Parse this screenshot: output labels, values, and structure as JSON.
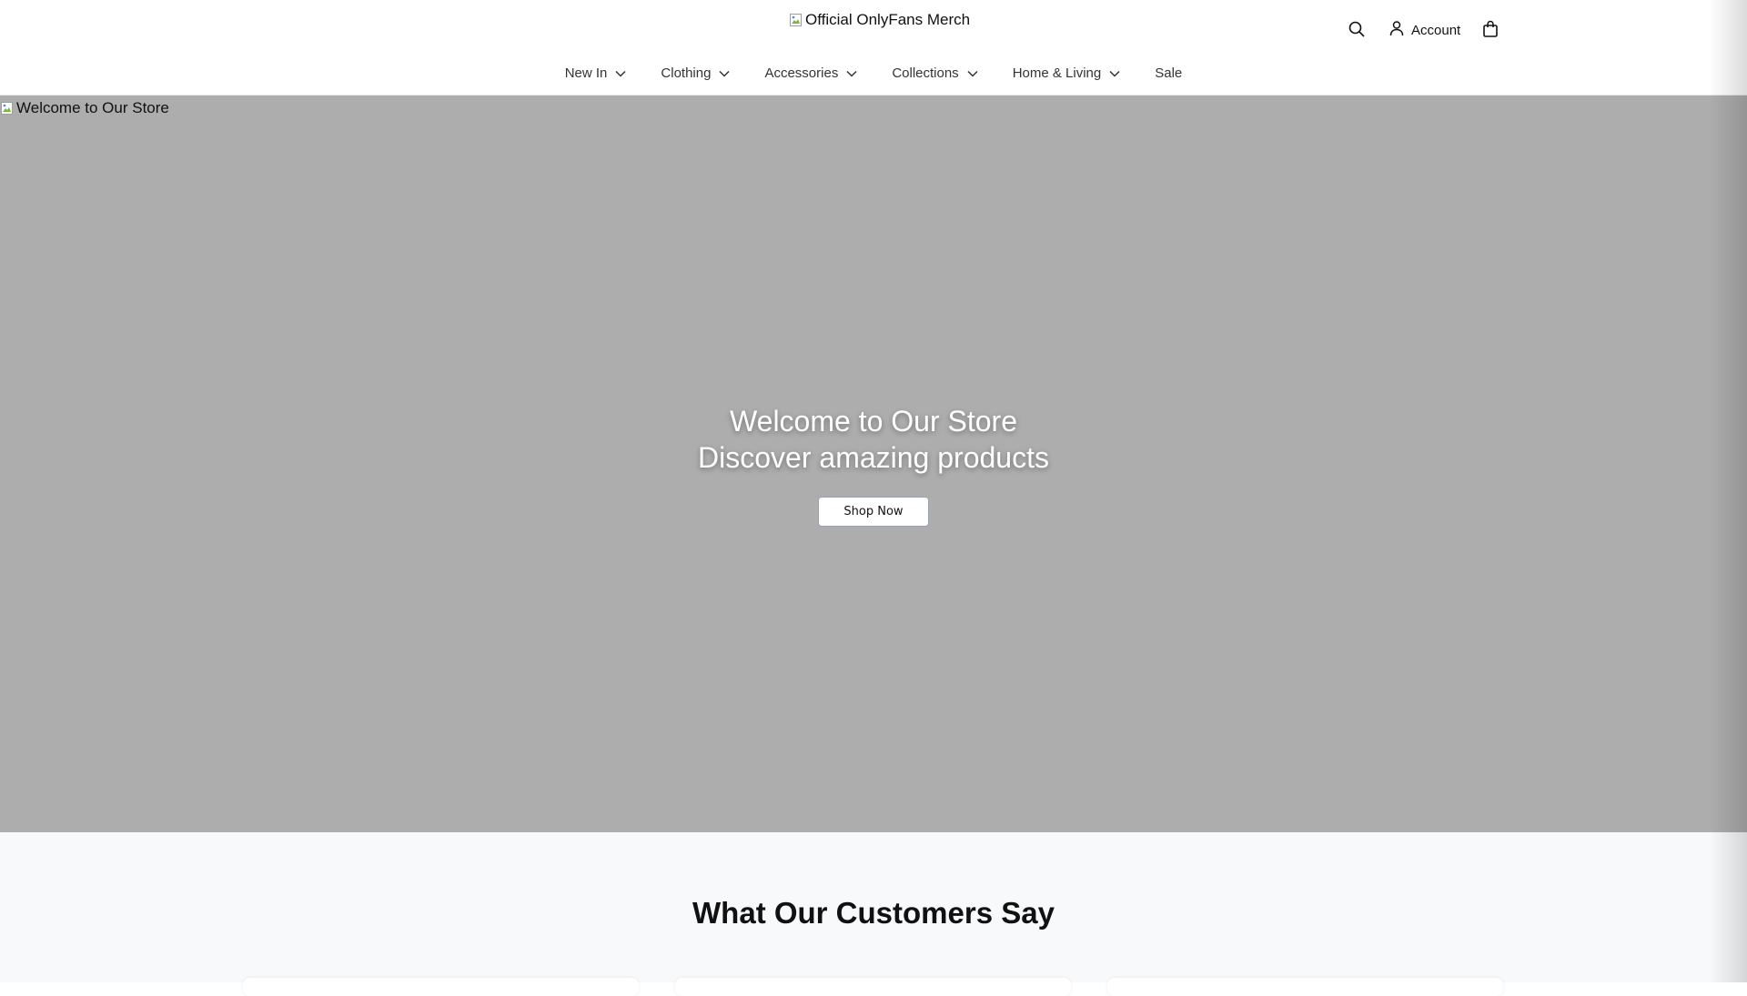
{
  "header": {
    "logo_alt": "Official OnlyFans Merch",
    "account_label": "Account"
  },
  "nav": {
    "items": [
      {
        "label": "New In",
        "has_dropdown": true
      },
      {
        "label": "Clothing",
        "has_dropdown": true
      },
      {
        "label": "Accessories",
        "has_dropdown": true
      },
      {
        "label": "Collections",
        "has_dropdown": true
      },
      {
        "label": "Home & Living",
        "has_dropdown": true
      },
      {
        "label": "Sale",
        "has_dropdown": false
      }
    ]
  },
  "hero": {
    "image_alt": "Welcome to Our Store",
    "title_line1": "Welcome to Our Store",
    "title_line2": "Discover amazing products",
    "button_label": "Shop Now",
    "background": "#adadad"
  },
  "testimonials": {
    "title": "What Our Customers Say",
    "background": "#f8f9fb"
  },
  "icons": [
    "broken-image-icon",
    "search-icon",
    "user-icon",
    "shopping-bag-icon",
    "chevron-down-icon"
  ]
}
